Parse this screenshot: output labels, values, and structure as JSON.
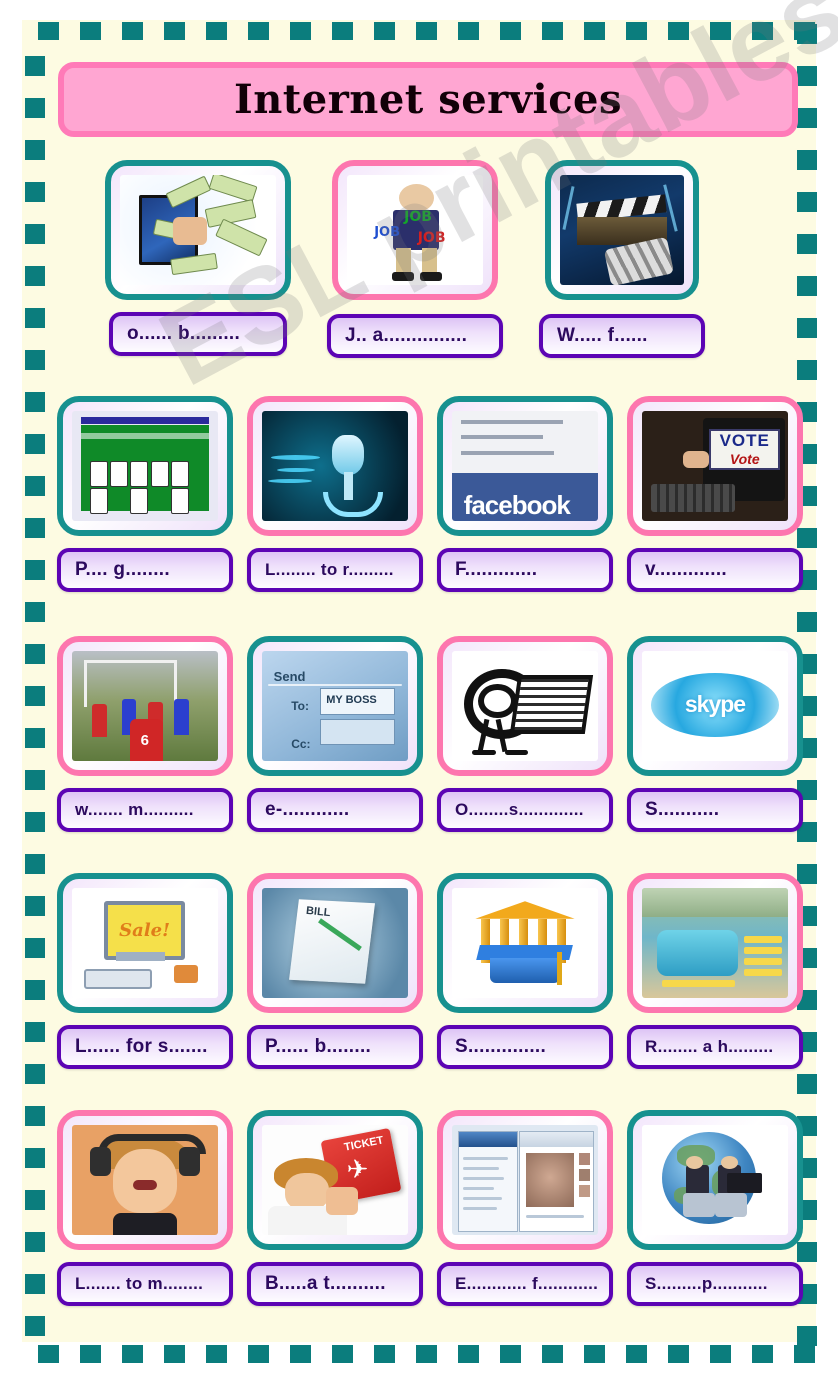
{
  "page": {
    "title": "Internet services",
    "watermark": "ESL printables.com",
    "background_color": "#fdfbe2",
    "border_color": "#0b7d7d",
    "title_fill": "#ffa6d2",
    "title_border": "#ff7ab8",
    "plate_border": "#5c04b4",
    "plate_text_color": "#2c0a5e",
    "frame_teal": "#17918f",
    "frame_pink": "#fd76ae"
  },
  "rows": [
    {
      "cells": [
        {
          "frame": "teal",
          "image": "online-banking-money-computer",
          "label": "o...... b........."
        },
        {
          "frame": "pink",
          "image": "job-search-character",
          "label": "J..   a..............."
        },
        {
          "frame": "teal",
          "image": "watching-films-clapperboard",
          "label": "W..... f......"
        }
      ]
    },
    {
      "cells": [
        {
          "frame": "teal",
          "image": "playing-games-solitaire",
          "label": "P....  g........"
        },
        {
          "frame": "pink",
          "image": "listening-to-radio-microphone",
          "label": "L........ to r........."
        },
        {
          "frame": "teal",
          "image": "facebook-page",
          "label": "F............."
        },
        {
          "frame": "pink",
          "image": "voting-computer",
          "label": "v............."
        }
      ]
    },
    {
      "cells": [
        {
          "frame": "pink",
          "image": "watching-matches-football",
          "label": "w....... m.........."
        },
        {
          "frame": "teal",
          "image": "email-send-to-my-boss",
          "label": "e-............"
        },
        {
          "frame": "pink",
          "image": "online-shopping-at-cart",
          "label": "O........s............."
        },
        {
          "frame": "teal",
          "image": "skype-logo",
          "label": "S..........."
        }
      ]
    },
    {
      "cells": [
        {
          "frame": "teal",
          "image": "looking-for-sales-computer",
          "label": "L...... for s......."
        },
        {
          "frame": "pink",
          "image": "paying-bills-document",
          "label": "P...... b........"
        },
        {
          "frame": "teal",
          "image": "studying-university-graduation-cap",
          "label": "S.............."
        },
        {
          "frame": "pink",
          "image": "reserving-a-hotel-pool",
          "label": "R........ a h........."
        }
      ]
    },
    {
      "cells": [
        {
          "frame": "pink",
          "image": "listening-to-music-headphones",
          "label": "L....... to m........"
        },
        {
          "frame": "teal",
          "image": "booking-a-ticket-plane",
          "label": "B.....a t.........."
        },
        {
          "frame": "pink",
          "image": "exchanging-files-video-chat",
          "label": "E............ f............"
        },
        {
          "frame": "teal",
          "image": "social-pages-globe-laptop",
          "label": "S.........p..........."
        }
      ]
    }
  ],
  "image_texts": {
    "job": "JOB",
    "skype": "skype",
    "facebook": "facebook",
    "vote": "VOTE",
    "vote_small": "Vote",
    "mail_send": "Send",
    "mail_to": "To:",
    "mail_boss": "MY BOSS",
    "mail_cc": "Cc:",
    "sale": "Sale!",
    "bill": "BILL",
    "ticket": "TICKET"
  }
}
